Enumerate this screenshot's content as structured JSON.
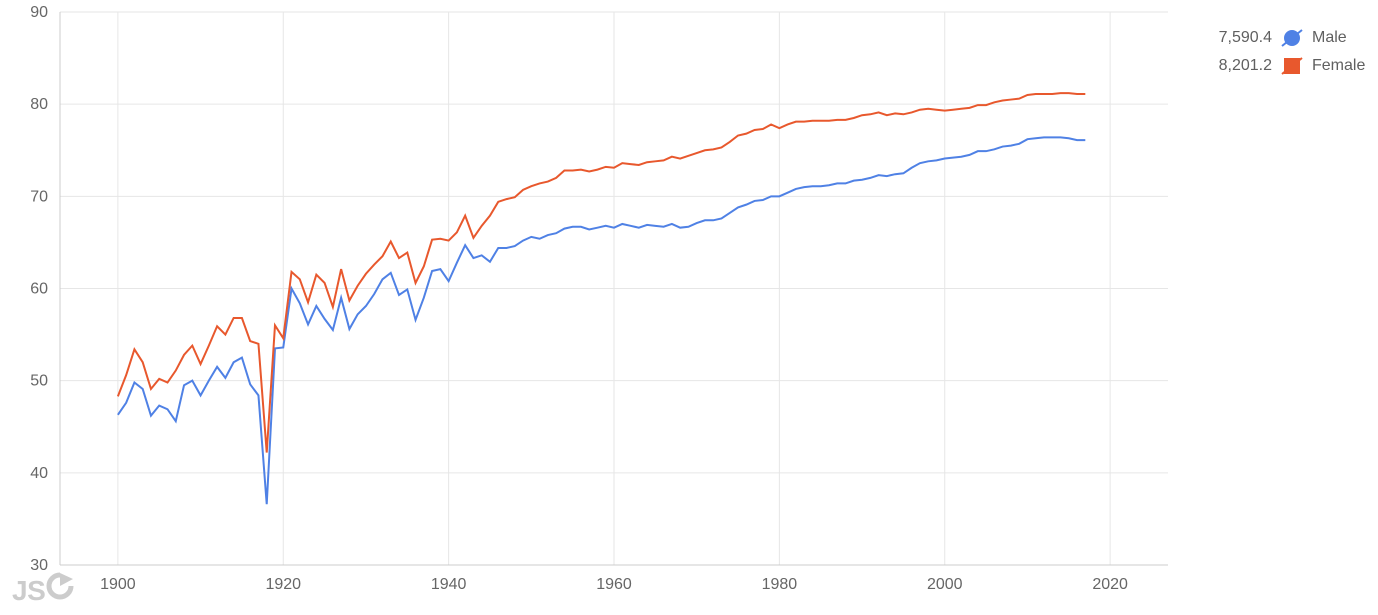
{
  "chart_data": {
    "type": "line",
    "x_start": 1900,
    "x_end": 2017,
    "xlim": [
      1893,
      2027
    ],
    "ylim": [
      30,
      90
    ],
    "x_ticks": [
      1900,
      1920,
      1940,
      1960,
      1980,
      2000,
      2020
    ],
    "y_ticks": [
      30,
      40,
      50,
      60,
      70,
      80,
      90
    ],
    "colors": {
      "male": "#4f81e5",
      "female": "#e8582d"
    },
    "series": [
      {
        "name": "Male",
        "legend_value": "7,590.4",
        "color_key": "male",
        "values": [
          46.3,
          47.6,
          49.8,
          49.1,
          46.2,
          47.3,
          46.9,
          45.6,
          49.5,
          50.0,
          48.4,
          50.0,
          51.5,
          50.3,
          52.0,
          52.5,
          49.6,
          48.4,
          36.6,
          53.5,
          53.6,
          60.0,
          58.4,
          56.1,
          58.1,
          56.7,
          55.5,
          59.0,
          55.6,
          57.2,
          58.1,
          59.4,
          61.0,
          61.7,
          59.3,
          59.9,
          56.6,
          59.0,
          61.9,
          62.1,
          60.8,
          62.8,
          64.7,
          63.3,
          63.6,
          62.9,
          64.4,
          64.4,
          64.6,
          65.2,
          65.6,
          65.4,
          65.8,
          66.0,
          66.5,
          66.7,
          66.7,
          66.4,
          66.6,
          66.8,
          66.6,
          67.0,
          66.8,
          66.6,
          66.9,
          66.8,
          66.7,
          67.0,
          66.6,
          66.7,
          67.1,
          67.4,
          67.4,
          67.6,
          68.2,
          68.8,
          69.1,
          69.5,
          69.6,
          70.0,
          70.0,
          70.4,
          70.8,
          71.0,
          71.1,
          71.1,
          71.2,
          71.4,
          71.4,
          71.7,
          71.8,
          72.0,
          72.3,
          72.2,
          72.4,
          72.5,
          73.1,
          73.6,
          73.8,
          73.9,
          74.1,
          74.2,
          74.3,
          74.5,
          74.9,
          74.9,
          75.1,
          75.4,
          75.5,
          75.7,
          76.2,
          76.3,
          76.4,
          76.4,
          76.4,
          76.3,
          76.1,
          76.1
        ]
      },
      {
        "name": "Female",
        "legend_value": "8,201.2",
        "color_key": "female",
        "values": [
          48.3,
          50.6,
          53.4,
          52.0,
          49.1,
          50.2,
          49.8,
          51.1,
          52.8,
          53.8,
          51.8,
          53.8,
          55.9,
          55.0,
          56.8,
          56.8,
          54.3,
          54.0,
          42.2,
          56.0,
          54.6,
          61.8,
          61.0,
          58.5,
          61.5,
          60.6,
          58.0,
          62.1,
          58.7,
          60.3,
          61.6,
          62.6,
          63.5,
          65.1,
          63.3,
          63.9,
          60.6,
          62.4,
          65.3,
          65.4,
          65.2,
          66.1,
          67.9,
          65.5,
          66.8,
          67.9,
          69.4,
          69.7,
          69.9,
          70.7,
          71.1,
          71.4,
          71.6,
          72.0,
          72.8,
          72.8,
          72.9,
          72.7,
          72.9,
          73.2,
          73.1,
          73.6,
          73.5,
          73.4,
          73.7,
          73.8,
          73.9,
          74.3,
          74.1,
          74.4,
          74.7,
          75.0,
          75.1,
          75.3,
          75.9,
          76.6,
          76.8,
          77.2,
          77.3,
          77.8,
          77.4,
          77.8,
          78.1,
          78.1,
          78.2,
          78.2,
          78.2,
          78.3,
          78.3,
          78.5,
          78.8,
          78.9,
          79.1,
          78.8,
          79.0,
          78.9,
          79.1,
          79.4,
          79.5,
          79.4,
          79.3,
          79.4,
          79.5,
          79.6,
          79.9,
          79.9,
          80.2,
          80.4,
          80.5,
          80.6,
          81.0,
          81.1,
          81.1,
          81.1,
          81.2,
          81.2,
          81.1,
          81.1
        ]
      }
    ]
  },
  "legend": {
    "rows": [
      {
        "value": "7,590.4",
        "name": "Male",
        "swatch": "male-marker"
      },
      {
        "value": "8,201.2",
        "name": "Female",
        "swatch": "female-marker"
      }
    ]
  },
  "watermark": {
    "text": "JS"
  }
}
